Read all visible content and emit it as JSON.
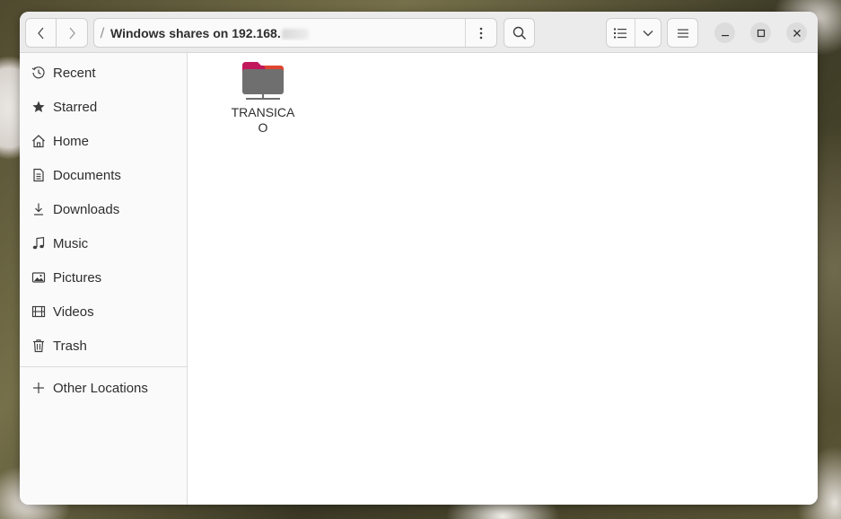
{
  "header": {
    "path_separator": "/",
    "path_title": "Windows shares on 192.168.",
    "path_redacted": true
  },
  "sidebar": {
    "items": [
      {
        "label": "Recent",
        "icon": "clock-icon"
      },
      {
        "label": "Starred",
        "icon": "star-icon"
      },
      {
        "label": "Home",
        "icon": "home-icon"
      },
      {
        "label": "Documents",
        "icon": "document-icon"
      },
      {
        "label": "Downloads",
        "icon": "download-icon"
      },
      {
        "label": "Music",
        "icon": "music-note-icon"
      },
      {
        "label": "Pictures",
        "icon": "picture-icon"
      },
      {
        "label": "Videos",
        "icon": "film-icon"
      },
      {
        "label": "Trash",
        "icon": "trash-icon"
      }
    ],
    "other_locations": {
      "label": "Other Locations",
      "icon": "plus-icon"
    }
  },
  "content": {
    "files": [
      {
        "name": "TRANSICAO",
        "icon": "network-folder-icon"
      }
    ]
  },
  "colors": {
    "folder_tab": "#c2185b",
    "folder_tab_accent": "#e95420",
    "folder_body": "#6f6f6f"
  }
}
